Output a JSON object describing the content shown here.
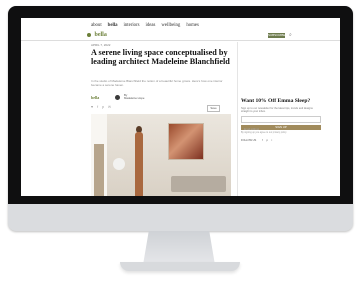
{
  "site": {
    "nav": [
      "about",
      "bella",
      "interiors",
      "ideas",
      "wellbeing",
      "homes"
    ],
    "active_nav_index": 1,
    "logo": "bella",
    "subscribe_label": "SUBSCRIBE",
    "search_icon": "search-icon"
  },
  "article": {
    "date": "APRIL 7, 2022",
    "headline": "A serene living space conceptualised by leading architect Madeleine Blanchfield",
    "dek": "In the studio of Madeleine Blanchfield the notion of a beautiful home grows. Here's how one interior became a serene haven.",
    "byline_logo": "bella",
    "byline_label": "By",
    "byline_name": "Madeleine Hope",
    "share_icons": [
      "♥",
      "f",
      "p",
      "✉"
    ],
    "save_label": "Save"
  },
  "sidebar": {
    "promo_title": "Want 10% Off Emma Sleep?",
    "promo_text": "Sign up to our newsletter for the latest tips, trends and designs straight to your inbox.",
    "email_placeholder": "Email address",
    "signup_label": "SIGN UP",
    "legal": "By signing up you agree to our privacy policy",
    "follow_label": "FOLLOW US",
    "social_icons": [
      "f",
      "p",
      "i"
    ]
  },
  "monitor": {
    "brand_icon": "apple-logo-icon"
  }
}
